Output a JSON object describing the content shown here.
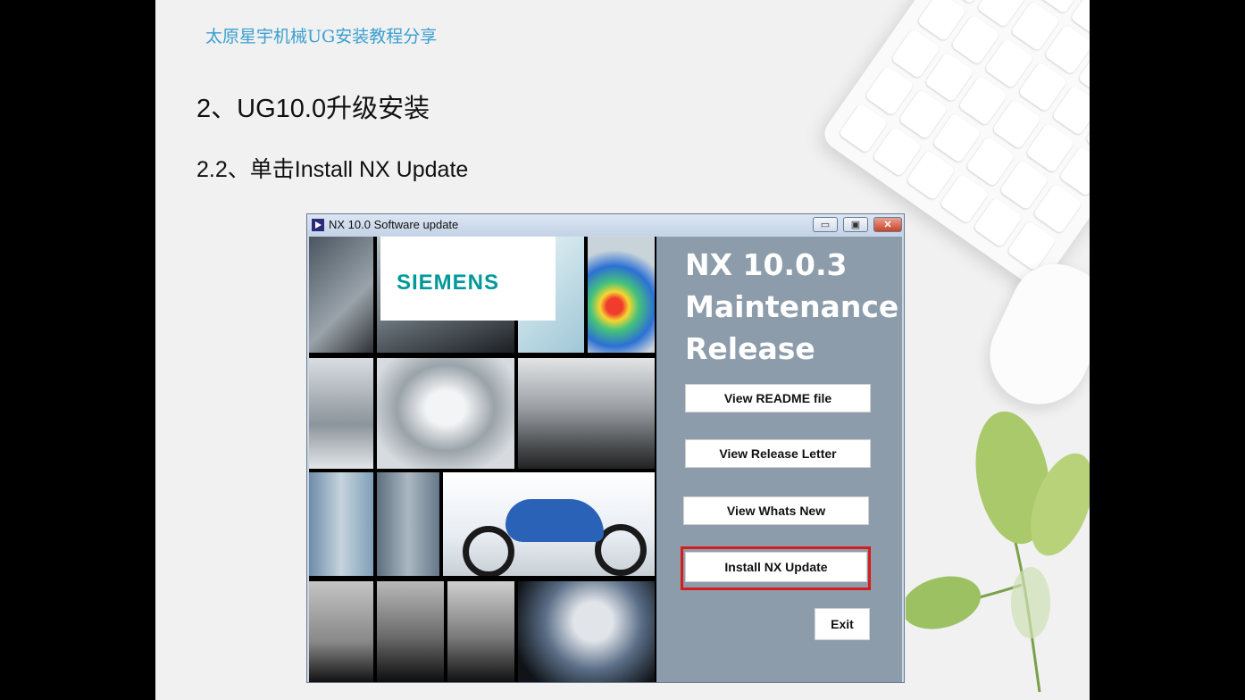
{
  "slide": {
    "header_note": "太原星宇机械UG安装教程分享",
    "title": "2、UG10.0升级安装",
    "subtitle": "2.2、单击Install NX Update"
  },
  "window": {
    "title": "NX 10.0 Software update",
    "controls": {
      "minimize": "▭",
      "maximize": "▣",
      "close": "✕"
    },
    "logo": "SIEMENS",
    "release_lines": [
      "NX 10.0.3",
      "Maintenance",
      "Release"
    ],
    "buttons": {
      "readme": "View README file",
      "release_letter": "View Release Letter",
      "whats_new": "View Whats New",
      "install": "Install NX Update",
      "exit": "Exit"
    }
  },
  "colors": {
    "header_note": "#3a9fd0",
    "panel": "#8d9cab",
    "highlight": "#d81c1c",
    "siemens": "#009999"
  }
}
